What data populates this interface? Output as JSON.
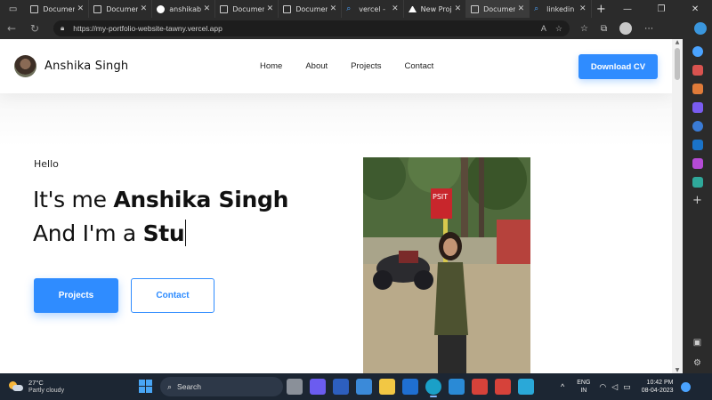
{
  "browser": {
    "tabs": [
      {
        "title": "Documen",
        "icon": "document-icon",
        "active": false
      },
      {
        "title": "Documen",
        "icon": "document-icon",
        "active": false
      },
      {
        "title": "anshikab",
        "icon": "github-icon",
        "active": false
      },
      {
        "title": "Documen",
        "icon": "document-icon",
        "active": false
      },
      {
        "title": "Documen",
        "icon": "document-icon",
        "active": false
      },
      {
        "title": "vercel - ",
        "icon": "search-icon",
        "active": false
      },
      {
        "title": "New Proj",
        "icon": "vercel-icon",
        "active": false
      },
      {
        "title": "Documen",
        "icon": "document-icon",
        "active": true
      },
      {
        "title": "linkedin",
        "icon": "search-icon",
        "active": false
      }
    ],
    "tab_close": "✕",
    "new_tab": "+",
    "url": "https://my-portfolio-website-tawny.vercel.app"
  },
  "site": {
    "brand_name": "Anshika Singh",
    "nav": [
      "Home",
      "About",
      "Projects",
      "Contact"
    ],
    "cv_button": "Download CV",
    "hello": "Hello",
    "intro_prefix": "It's me ",
    "intro_name": "Anshika Singh",
    "role_prefix": "And I'm a ",
    "role_typed": "Stu",
    "projects_button": "Projects",
    "contact_button": "Contact",
    "photo_sign_text": "PSIT"
  },
  "taskbar": {
    "temperature": "27°C",
    "weather": "Partly cloudy",
    "search_label": "Search",
    "lang_top": "ENG",
    "lang_bottom": "IN",
    "time": "10:42 PM",
    "date": "08-04-2023"
  },
  "colors": {
    "accent": "#2f8cff",
    "taskbar": "#1c2633",
    "browser_chrome": "#2b2b2b"
  }
}
